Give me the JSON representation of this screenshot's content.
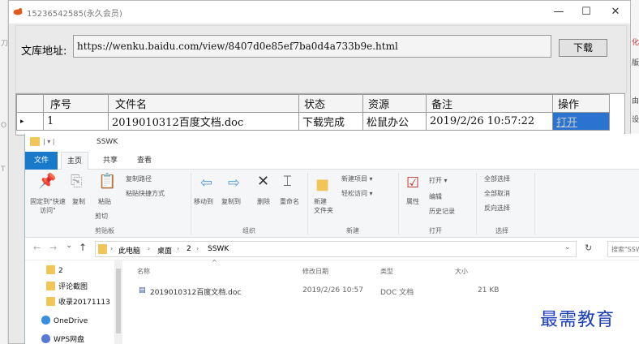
{
  "background": {
    "left_labels": [
      "刀",
      "O",
      "T"
    ],
    "right_labels": [
      "化",
      "版",
      "由",
      "设"
    ]
  },
  "downloader": {
    "title": "15236542585(永久会员)",
    "controls": {
      "minimize": "—",
      "maximize": "☐",
      "close": "✕"
    },
    "url_label": "文库地址:",
    "url_value": "https://wenku.baidu.com/view/8407d0e85ef7ba0d4a733b9e.html",
    "download_button": "下载",
    "table": {
      "headers": [
        "序号",
        "文件名",
        "状态",
        "资源",
        "备注",
        "操作"
      ],
      "rows": [
        {
          "marker": "▸",
          "index": "1",
          "filename": "2019010312百度文档.doc",
          "status": "下载完成",
          "source": "松鼠办公",
          "note": "2019/2/26 10:57:22",
          "action": "打开"
        }
      ]
    }
  },
  "explorer": {
    "title": "SSWK",
    "title_sep": "| ▾ |",
    "tabs": [
      "文件",
      "主页",
      "共享",
      "查看"
    ],
    "ribbon": {
      "clipboard": {
        "pin_label": "固定到\"快速访问\"",
        "copy": "复制",
        "paste": "粘贴",
        "copy_path": "复制路径",
        "paste_shortcut": "粘贴快捷方式",
        "cut": "剪切",
        "group": "剪贴板"
      },
      "organize": {
        "move_to": "移动到",
        "copy_to": "复制到",
        "delete": "删除",
        "rename": "重命名",
        "group": "组织"
      },
      "new": {
        "new_folder": "新建\n文件夹",
        "new_item": "新建项目 ▾",
        "easy_access": "轻松访问 ▾",
        "group": "新建"
      },
      "open": {
        "properties": "属性",
        "open": "打开 ▾",
        "edit": "编辑",
        "history": "历史记录",
        "group": "打开"
      },
      "select": {
        "select_all": "全部选择",
        "select_none": "全部取消",
        "invert": "反向选择",
        "group": "选择"
      }
    },
    "address": {
      "nav": [
        "←",
        "→",
        "⌄",
        "↑"
      ],
      "path": [
        "此电脑",
        "桌面",
        "2",
        "SSWK"
      ],
      "sep": "›",
      "search": "搜索\"SSWK\""
    },
    "nav_items": [
      "2",
      "评论截图",
      "收录20171113",
      "OneDrive",
      "WPS网盘"
    ],
    "columns": [
      "名称",
      "修改日期",
      "类型",
      "大小"
    ],
    "files": [
      {
        "name": "2019010312百度文档.doc",
        "date": "2019/2/26 10:57",
        "type": "DOC 文档",
        "size": "21 KB"
      }
    ]
  },
  "watermark": "最需教育",
  "colors": {
    "accent": "#1979ca",
    "selection": "#2a74d0",
    "folder": "#f2c558",
    "watermark": "#1a3db8"
  }
}
